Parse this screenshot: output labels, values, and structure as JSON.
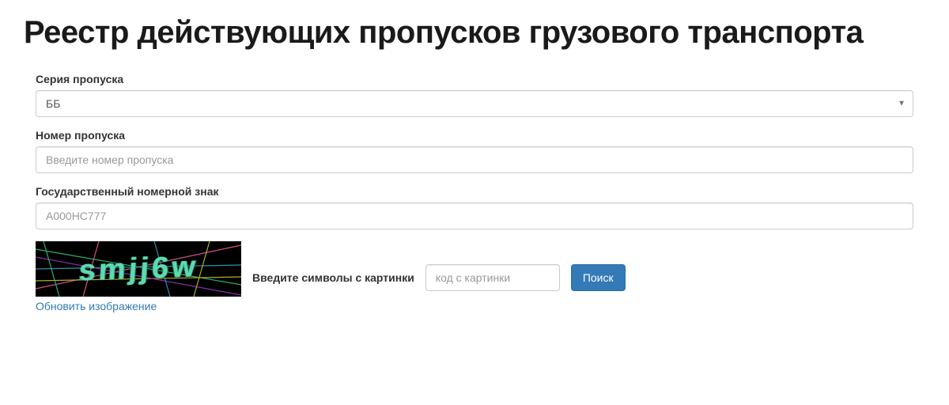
{
  "page_title": "Реестр действующих пропусков грузового транспорта",
  "form": {
    "series": {
      "label": "Серия пропуска",
      "value": "ББ"
    },
    "number": {
      "label": "Номер пропуска",
      "placeholder": "Введите номер пропуска",
      "value": ""
    },
    "plate": {
      "label": "Государственный номерной знак",
      "placeholder": "А000НС777",
      "value": ""
    },
    "captcha": {
      "image_text": "smjj6w",
      "refresh_label": "Обновить изображение",
      "prompt_label": "Введите символы с картинки",
      "input_placeholder": "код с картинки",
      "input_value": "",
      "search_button": "Поиск"
    }
  }
}
